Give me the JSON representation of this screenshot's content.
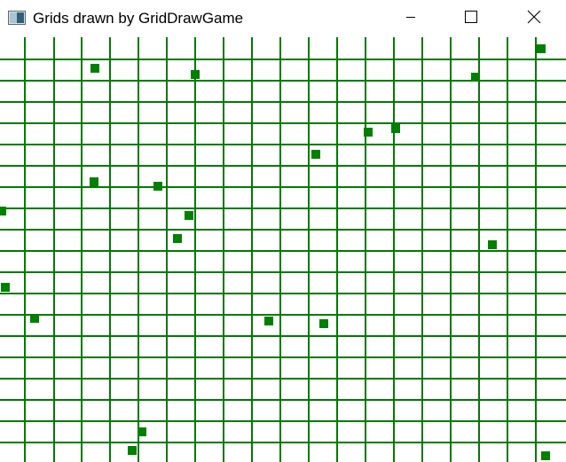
{
  "window": {
    "title": "Grids drawn by GridDrawGame",
    "icon": "app-window-icon",
    "controls": [
      "minimize-icon",
      "maximize-icon",
      "close-icon"
    ]
  },
  "canvas": {
    "background": "#ffffff",
    "grid_color": "#007a00",
    "cell_color": "#008000",
    "grid_columns": 20,
    "grid_rows": 20,
    "filled_cells": 22
  }
}
